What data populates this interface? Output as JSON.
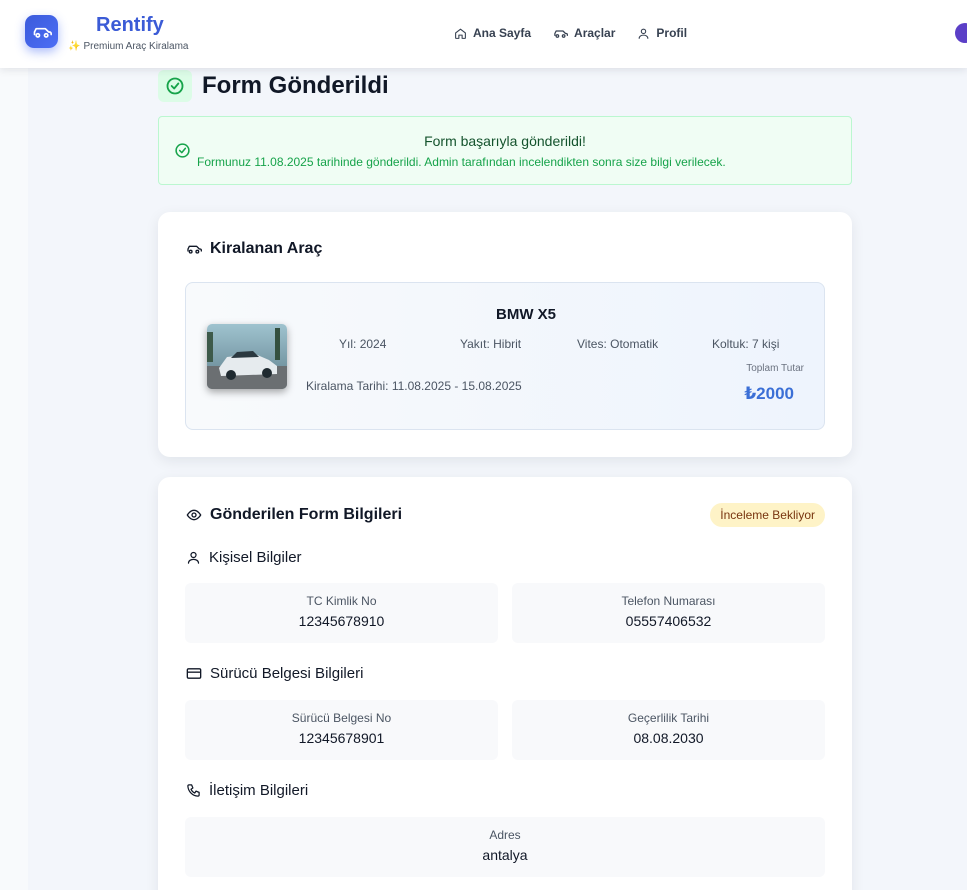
{
  "brand": {
    "title": "Rentify",
    "subtitle": "Premium Araç Kiralama"
  },
  "nav": {
    "items": [
      {
        "label": "Ana Sayfa",
        "icon": "home-icon"
      },
      {
        "label": "Araçlar",
        "icon": "car-icon"
      },
      {
        "label": "Profil",
        "icon": "user-icon"
      }
    ]
  },
  "page": {
    "title": "Form Gönderildi"
  },
  "alert": {
    "title": "Form başarıyla gönderildi!",
    "text": "Formunuz 11.08.2025 tarihinde gönderildi. Admin tarafından incelendikten sonra size bilgi verilecek."
  },
  "rental_card": {
    "header": "Kiralanan Araç",
    "car_name": "BMW X5",
    "specs": [
      {
        "label": "Yıl:",
        "value": "2024"
      },
      {
        "label": "Yakıt:",
        "value": "Hibrit"
      },
      {
        "label": "Vites:",
        "value": "Otomatik"
      },
      {
        "label": "Koltuk:",
        "value": "7 kişi"
      }
    ],
    "dates_label": "Kiralama Tarihi:",
    "dates_value": "11.08.2025 - 15.08.2025",
    "total_label": "Toplam Tutar",
    "total_value": "₺2000"
  },
  "form_card": {
    "header": "Gönderilen Form Bilgileri",
    "status_badge": "İnceleme Bekliyor",
    "personal": {
      "title": "Kişisel Bilgiler",
      "fields": [
        {
          "label": "TC Kimlik No",
          "value": "12345678910"
        },
        {
          "label": "Telefon Numarası",
          "value": "05557406532"
        }
      ]
    },
    "license": {
      "title": "Sürücü Belgesi Bilgileri",
      "fields": [
        {
          "label": "Sürücü Belgesi No",
          "value": "12345678901"
        },
        {
          "label": "Geçerlilik Tarihi",
          "value": "08.08.2030"
        }
      ]
    },
    "contact": {
      "title": "İletişim Bilgileri",
      "fields": [
        {
          "label": "Adres",
          "value": "antalya"
        }
      ]
    }
  },
  "colors": {
    "brand": "#3b5bd6",
    "success": "#16a34a",
    "price": "#3b6fd6",
    "badge_bg": "#fef3c7"
  }
}
